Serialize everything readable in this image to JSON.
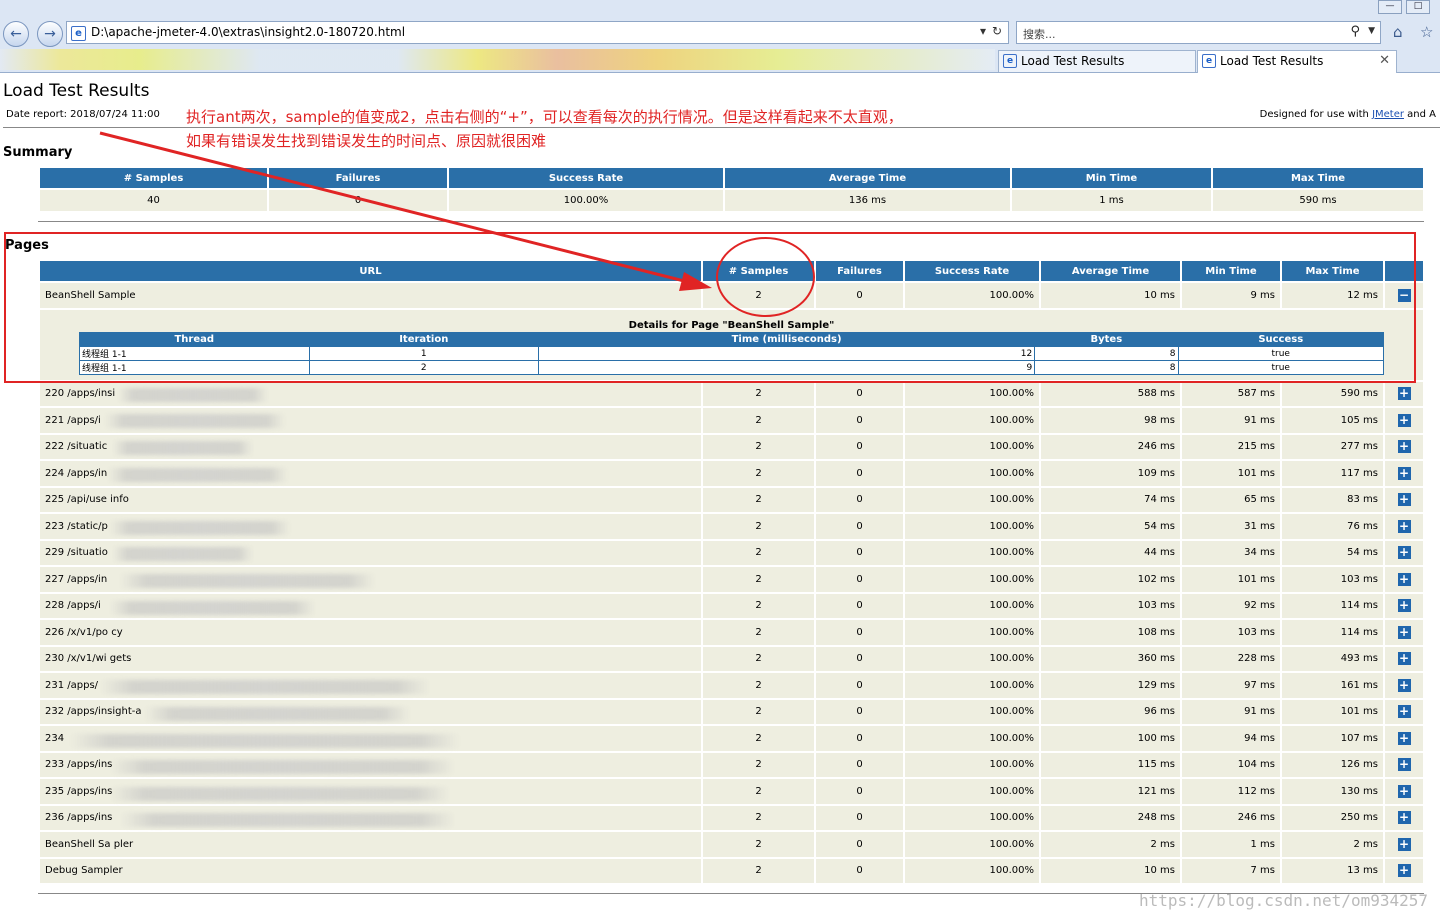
{
  "browser": {
    "address": "D:\\apache-jmeter-4.0\\extras\\insight2.0-180720.html",
    "search_placeholder": "搜索...",
    "tabs": [
      {
        "label": "Load Test Results"
      },
      {
        "label": "Load Test Results"
      }
    ]
  },
  "report": {
    "title": "Load Test Results",
    "date_report": "Date report: 2018/07/24 11:00",
    "designed_prefix": "Designed for use with ",
    "designed_link": "JMeter",
    "designed_suffix": " and A",
    "summary_title": "Summary",
    "summary_headers": [
      "# Samples",
      "Failures",
      "Success Rate",
      "Average Time",
      "Min Time",
      "Max Time"
    ],
    "summary_values": [
      "40",
      "0",
      "100.00%",
      "136 ms",
      "1 ms",
      "590 ms"
    ],
    "pages_title": "Pages",
    "pages_headers": [
      "URL",
      "# Samples",
      "Failures",
      "Success Rate",
      "Average Time",
      "Min Time",
      "Max Time"
    ],
    "rows": [
      {
        "url": "BeanShell Sample",
        "samples": "2",
        "failures": "0",
        "rate": "100.00%",
        "avg": "10 ms",
        "min": "9 ms",
        "max": "12 ms",
        "expanded": true
      },
      {
        "url": "220 /apps/insi",
        "samples": "2",
        "failures": "0",
        "rate": "100.00%",
        "avg": "588 ms",
        "min": "587 ms",
        "max": "590 ms"
      },
      {
        "url": "221 /apps/i",
        "samples": "2",
        "failures": "0",
        "rate": "100.00%",
        "avg": "98 ms",
        "min": "91 ms",
        "max": "105 ms"
      },
      {
        "url": "222 /situatic",
        "samples": "2",
        "failures": "0",
        "rate": "100.00%",
        "avg": "246 ms",
        "min": "215 ms",
        "max": "277 ms"
      },
      {
        "url": "224 /apps/in",
        "samples": "2",
        "failures": "0",
        "rate": "100.00%",
        "avg": "109 ms",
        "min": "101 ms",
        "max": "117 ms"
      },
      {
        "url": "225 /api/use info",
        "samples": "2",
        "failures": "0",
        "rate": "100.00%",
        "avg": "74 ms",
        "min": "65 ms",
        "max": "83 ms"
      },
      {
        "url": "223 /static/p",
        "samples": "2",
        "failures": "0",
        "rate": "100.00%",
        "avg": "54 ms",
        "min": "31 ms",
        "max": "76 ms"
      },
      {
        "url": "229 /situatio",
        "samples": "2",
        "failures": "0",
        "rate": "100.00%",
        "avg": "44 ms",
        "min": "34 ms",
        "max": "54 ms"
      },
      {
        "url": "227 /apps/in",
        "samples": "2",
        "failures": "0",
        "rate": "100.00%",
        "avg": "102 ms",
        "min": "101 ms",
        "max": "103 ms"
      },
      {
        "url": "228 /apps/i",
        "samples": "2",
        "failures": "0",
        "rate": "100.00%",
        "avg": "103 ms",
        "min": "92 ms",
        "max": "114 ms"
      },
      {
        "url": "226 /x/v1/po cy",
        "samples": "2",
        "failures": "0",
        "rate": "100.00%",
        "avg": "108 ms",
        "min": "103 ms",
        "max": "114 ms"
      },
      {
        "url": "230 /x/v1/wi gets",
        "samples": "2",
        "failures": "0",
        "rate": "100.00%",
        "avg": "360 ms",
        "min": "228 ms",
        "max": "493 ms"
      },
      {
        "url": "231 /apps/",
        "samples": "2",
        "failures": "0",
        "rate": "100.00%",
        "avg": "129 ms",
        "min": "97 ms",
        "max": "161 ms"
      },
      {
        "url": "232 /apps/insight-a",
        "samples": "2",
        "failures": "0",
        "rate": "100.00%",
        "avg": "96 ms",
        "min": "91 ms",
        "max": "101 ms"
      },
      {
        "url": "234",
        "samples": "2",
        "failures": "0",
        "rate": "100.00%",
        "avg": "100 ms",
        "min": "94 ms",
        "max": "107 ms"
      },
      {
        "url": "233 /apps/ins",
        "samples": "2",
        "failures": "0",
        "rate": "100.00%",
        "avg": "115 ms",
        "min": "104 ms",
        "max": "126 ms"
      },
      {
        "url": "235 /apps/ins",
        "samples": "2",
        "failures": "0",
        "rate": "100.00%",
        "avg": "121 ms",
        "min": "112 ms",
        "max": "130 ms"
      },
      {
        "url": "236 /apps/ins",
        "samples": "2",
        "failures": "0",
        "rate": "100.00%",
        "avg": "248 ms",
        "min": "246 ms",
        "max": "250 ms"
      },
      {
        "url": "BeanShell Sa pler",
        "samples": "2",
        "failures": "0",
        "rate": "100.00%",
        "avg": "2 ms",
        "min": "1 ms",
        "max": "2 ms"
      },
      {
        "url": "Debug Sampler",
        "samples": "2",
        "failures": "0",
        "rate": "100.00%",
        "avg": "10 ms",
        "min": "7 ms",
        "max": "13 ms"
      }
    ],
    "details": {
      "title": "Details for Page \"BeanShell Sample\"",
      "headers": [
        "Thread",
        "Iteration",
        "Time (milliseconds)",
        "Bytes",
        "Success"
      ],
      "rows": [
        [
          "线程组 1-1",
          "1",
          "12",
          "8",
          "true"
        ],
        [
          "线程组 1-1",
          "2",
          "9",
          "8",
          "true"
        ]
      ]
    }
  },
  "annotation": {
    "line1": "执行ant两次，sample的值变成2，点击右侧的“+”，可以查看每次的执行情况。但是这样看起来不太直观，",
    "line2": "如果有错误发生找到错误发生的时间点、原因就很困难",
    "color": "#e02424"
  },
  "watermark": "https://blog.csdn.net/om934257",
  "colors": {
    "header": "#2a6fa8",
    "cell": "#eeeee0",
    "button": "#1f66ad"
  }
}
